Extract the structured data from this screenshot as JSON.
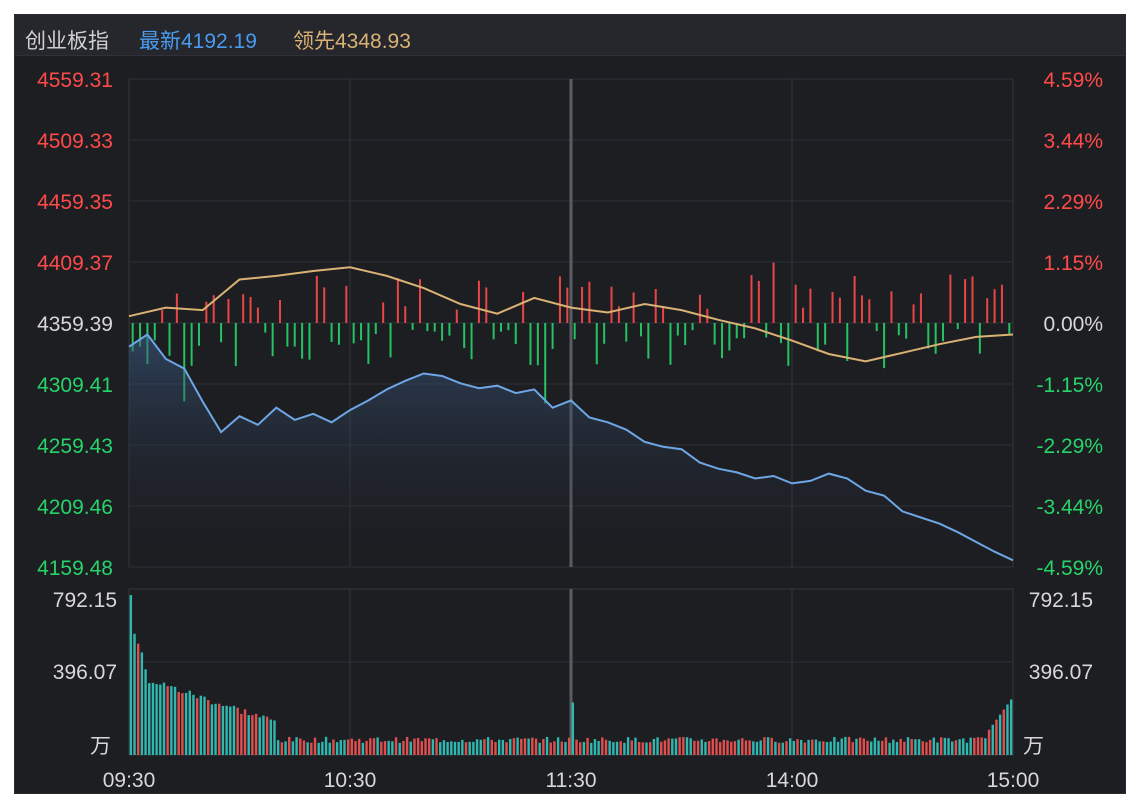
{
  "header": {
    "name": "创业板指",
    "latest": "最新4192.19",
    "lead": "领先4348.93"
  },
  "colors": {
    "up": "#ff4a4a",
    "down": "#27d46a",
    "neutral": "#d8d8d8",
    "price_line": "#6ea6e6",
    "lead_line": "#d9b274",
    "vol_up": "#e04e4e",
    "vol_down": "#2fb8b0"
  },
  "chart_data": [
    {
      "type": "line",
      "name": "price",
      "time_ticks": [
        "09:30",
        "10:30",
        "11:30",
        "14:00",
        "15:00"
      ],
      "y_ticks": [
        "4559.31",
        "4509.33",
        "4459.35",
        "4409.37",
        "4359.39",
        "4309.41",
        "4259.43",
        "4209.46",
        "4159.48"
      ],
      "y_ticks_right": [
        "4.59%",
        "3.44%",
        "2.29%",
        "1.15%",
        "0.00%",
        "-1.15%",
        "-2.29%",
        "-3.44%",
        "-4.59%"
      ],
      "ylim": [
        4159.48,
        4559.31
      ],
      "prev_close": 4359.39,
      "grid": true,
      "series": [
        {
          "key": "price",
          "x": [
            0,
            5,
            10,
            15,
            20,
            25,
            30,
            35,
            40,
            45,
            50,
            55,
            60,
            65,
            70,
            75,
            80,
            85,
            90,
            95,
            100,
            105,
            110,
            115,
            120,
            125,
            130,
            135,
            140,
            145,
            150,
            155,
            160,
            165,
            170,
            175,
            180,
            185,
            190,
            195,
            200,
            205,
            210,
            215,
            220,
            225,
            230,
            235,
            240
          ],
          "values": [
            4340,
            4350,
            4330,
            4322,
            4295,
            4270,
            4283,
            4276,
            4290,
            4280,
            4285,
            4278,
            4288,
            4296,
            4305,
            4312,
            4318,
            4316,
            4310,
            4306,
            4308,
            4302,
            4305,
            4290,
            4296,
            4282,
            4278,
            4272,
            4262,
            4258,
            4256,
            4245,
            4240,
            4237,
            4232,
            4234,
            4228,
            4230,
            4236,
            4232,
            4222,
            4218,
            4205,
            4200,
            4195,
            4188,
            4180,
            4172,
            4165
          ]
        },
        {
          "key": "lead",
          "x": [
            0,
            10,
            20,
            30,
            40,
            50,
            60,
            70,
            80,
            90,
            100,
            110,
            120,
            130,
            140,
            150,
            160,
            170,
            180,
            190,
            200,
            210,
            220,
            230,
            240
          ],
          "values": [
            4365,
            4372,
            4370,
            4395,
            4398,
            4402,
            4405,
            4398,
            4388,
            4375,
            4367,
            4380,
            4372,
            4368,
            4375,
            4370,
            4362,
            4355,
            4345,
            4334,
            4328,
            4335,
            4342,
            4348,
            4350
          ]
        }
      ]
    },
    {
      "type": "bar",
      "name": "volume",
      "y_ticks": [
        "792.15",
        "396.07"
      ],
      "unit": "万",
      "ylim": [
        0,
        792.15
      ],
      "bars": 240
    }
  ]
}
